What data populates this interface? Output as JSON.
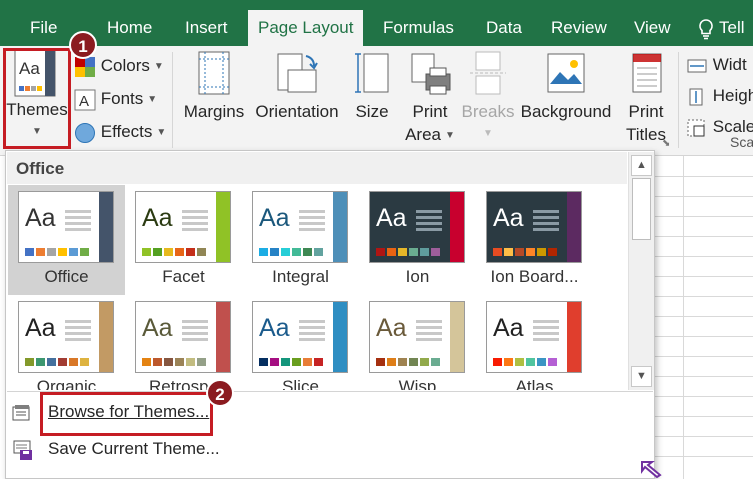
{
  "tabs": [
    {
      "label": "File"
    },
    {
      "label": "Home"
    },
    {
      "label": "Insert"
    },
    {
      "label": "Page Layout",
      "active": true
    },
    {
      "label": "Formulas"
    },
    {
      "label": "Data"
    },
    {
      "label": "Review"
    },
    {
      "label": "View"
    },
    {
      "label": "Tell"
    }
  ],
  "ribbon": {
    "themes_label": "Themes",
    "colors_label": "Colors",
    "fonts_label": "Fonts",
    "effects_label": "Effects",
    "margins_label": "Margins",
    "orientation_label": "Orientation",
    "size_label": "Size",
    "print_area_line1": "Print",
    "print_area_line2": "Area",
    "breaks_label": "Breaks",
    "background_label": "Background",
    "print_titles_line1": "Print",
    "print_titles_line2": "Titles",
    "width_label": "Widt",
    "height_label": "Heigh",
    "scale_label": "Scale",
    "scale_group_label": "Sca"
  },
  "dropdown": {
    "section_title": "Office",
    "themes": [
      {
        "name": "Office",
        "aa_color": "#333333",
        "accent": "#44546a",
        "swatches": [
          "#4472c4",
          "#ed7d31",
          "#a5a5a5",
          "#ffc000",
          "#5b9bd5",
          "#70ad47"
        ]
      },
      {
        "name": "Facet",
        "aa_color": "#2b3b12",
        "accent": "#90c226",
        "swatches": [
          "#90c226",
          "#54a021",
          "#e6b91e",
          "#e76618",
          "#c42f1a",
          "#918655"
        ]
      },
      {
        "name": "Integral",
        "aa_color": "#1b587c",
        "accent": "#4e8fb8",
        "swatches": [
          "#1cade4",
          "#2683c6",
          "#27ced7",
          "#42ba97",
          "#3e8853",
          "#62a39f"
        ]
      },
      {
        "name": "Ion",
        "aa_color": "#ffffff",
        "accent": "#c8002e",
        "swatches": [
          "#b01513",
          "#ea6312",
          "#e6b729",
          "#6aac90",
          "#5f9c9d",
          "#9e5e9b"
        ]
      },
      {
        "name": "Ion Board...",
        "aa_color": "#ffffff",
        "accent": "#5c2a61",
        "swatches": [
          "#e84c22",
          "#ffbd47",
          "#b64926",
          "#ff8427",
          "#cc9900",
          "#b22600"
        ]
      },
      {
        "name": "Organic",
        "aa_color": "#222222",
        "accent": "#c29a64",
        "swatches": [
          "#83992a",
          "#3c9770",
          "#44709d",
          "#a23c33",
          "#d97828",
          "#deb340"
        ]
      },
      {
        "name": "Retrospe",
        "aa_color": "#5a5a3a",
        "accent": "#c0504d",
        "swatches": [
          "#e48312",
          "#bd582c",
          "#865640",
          "#9b8357",
          "#c2bc80",
          "#94a088"
        ]
      },
      {
        "name": "Slice",
        "aa_color": "#1b5b8c",
        "accent": "#2f8ec2",
        "swatches": [
          "#052f61",
          "#a50e82",
          "#14967c",
          "#6a9e1f",
          "#e87d37",
          "#c62324"
        ]
      },
      {
        "name": "Wisp",
        "aa_color": "#6a5a3a",
        "accent": "#d4c59a",
        "swatches": [
          "#a53010",
          "#de7e18",
          "#9f8351",
          "#728653",
          "#92aa4c",
          "#6aac91"
        ]
      },
      {
        "name": "Atlas",
        "aa_color": "#222222",
        "accent": "#e03e2d",
        "swatches": [
          "#f81b02",
          "#fc7715",
          "#afbf41",
          "#50c49f",
          "#3b95c4",
          "#b560d4"
        ]
      }
    ],
    "menu": {
      "browse_label": "Browse for Themes...",
      "save_label": "Save Current Theme..."
    }
  },
  "callouts": {
    "step1": "1",
    "step2": "2"
  }
}
